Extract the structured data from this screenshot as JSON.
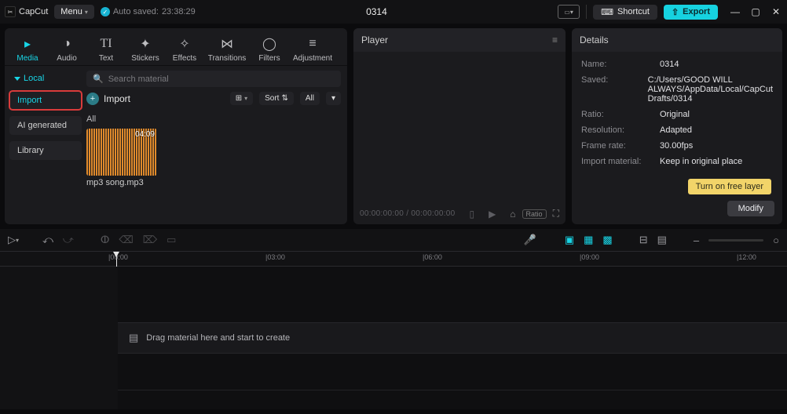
{
  "app": {
    "name": "CapCut",
    "menu_label": "Menu",
    "autosave_label": "Auto saved:",
    "autosave_time": "23:38:29",
    "project_title": "0314"
  },
  "titlebar": {
    "shortcut_label": "Shortcut",
    "export_label": "Export"
  },
  "media_tabs": [
    {
      "id": "media",
      "label": "Media",
      "icon": "▸"
    },
    {
      "id": "audio",
      "label": "Audio",
      "icon": "◑"
    },
    {
      "id": "text",
      "label": "Text",
      "icon": "T"
    },
    {
      "id": "stickers",
      "label": "Stickers",
      "icon": "✦"
    },
    {
      "id": "effects",
      "label": "Effects",
      "icon": "⋈"
    },
    {
      "id": "transitions",
      "label": "Transitions",
      "icon": "⋈"
    },
    {
      "id": "filters",
      "label": "Filters",
      "icon": "◴"
    },
    {
      "id": "adjustment",
      "label": "Adjustment",
      "icon": "≡"
    }
  ],
  "media_side": {
    "group": "Local",
    "items": [
      {
        "id": "import",
        "label": "Import",
        "selected": true
      },
      {
        "id": "ai",
        "label": "AI generated",
        "selected": false
      },
      {
        "id": "library",
        "label": "Library",
        "selected": false
      }
    ]
  },
  "media_main": {
    "search_placeholder": "Search material",
    "import_label": "Import",
    "view_label": "⊞",
    "sort_label": "Sort",
    "filter_all_label": "All",
    "section_all_label": "All",
    "clip": {
      "duration": "04:09",
      "filename": "mp3 song.mp3"
    }
  },
  "player": {
    "header": "Player",
    "time_current": "00:00:00:00",
    "time_total": "00:00:00:00",
    "ratio_chip": "Ratio"
  },
  "details": {
    "header": "Details",
    "rows": {
      "name_label": "Name:",
      "name_value": "0314",
      "saved_label": "Saved:",
      "saved_value": "C:/Users/GOOD WILL ALWAYS/AppData/Local/CapCut Drafts/0314",
      "ratio_label": "Ratio:",
      "ratio_value": "Original",
      "resolution_label": "Resolution:",
      "resolution_value": "Adapted",
      "framerate_label": "Frame rate:",
      "framerate_value": "30.00fps",
      "importmat_label": "Import material:",
      "importmat_value": "Keep in original place"
    },
    "tooltip": "Turn on free layer",
    "modify_label": "Modify"
  },
  "timeline": {
    "ticks": [
      "00:00",
      "03:00",
      "06:00",
      "09:00",
      "12:00"
    ],
    "dropzone_hint": "Drag material here and start to create"
  }
}
